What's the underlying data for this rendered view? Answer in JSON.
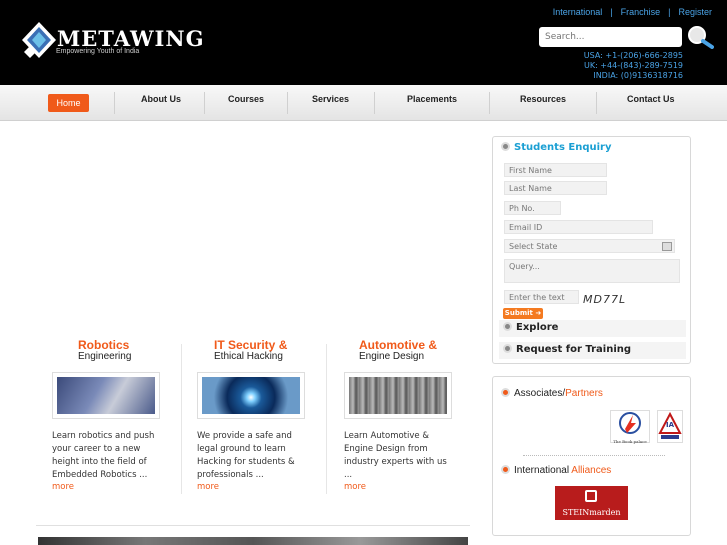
{
  "header": {
    "brand": "METAWING",
    "tagline": "Empowering Youth of India",
    "links": [
      "International",
      "Franchise",
      "Register"
    ],
    "search_placeholder": "Search...",
    "phones": [
      "USA: +1-(206)-666-2895",
      "UK: +44-(843)-289-7519",
      "INDIA: (0)9136318716"
    ]
  },
  "nav": {
    "items": [
      "Home",
      "About Us",
      "Courses",
      "Services",
      "Placements",
      "Resources",
      "Contact Us"
    ],
    "active_color": "#f05a1a"
  },
  "enquiry": {
    "title": "Students Enquiry",
    "first_name": "First Name",
    "last_name": "Last Name",
    "phone": "Ph No.",
    "email": "Email ID",
    "state": "Select State",
    "query": "Query...",
    "captcha_input": "Enter the text",
    "captcha": "MD77L",
    "submit": "Submit",
    "explore": "Explore",
    "training": "Request for Training"
  },
  "partners": {
    "associates_a": "Associates/",
    "associates_b": "Partners",
    "international_a": "International",
    "international_b": "Alliances",
    "logo1": "The Book palace",
    "logo2": "IA",
    "logo3": "STEINmarden"
  },
  "columns": [
    {
      "title": "Robotics",
      "subtitle": "Engineering",
      "desc": "Learn robotics and push your career to a new height into the field of Embedded Robotics ...",
      "more": "more"
    },
    {
      "title": "IT Security &",
      "subtitle": "Ethical Hacking",
      "desc": "We provide a safe and legal ground to learn Hacking for students & professionals ...",
      "more": "more"
    },
    {
      "title": "Automotive &",
      "subtitle": "Engine Design",
      "desc": "Learn Automotive & Engine Design from industry experts with us ...",
      "more": "more"
    }
  ]
}
